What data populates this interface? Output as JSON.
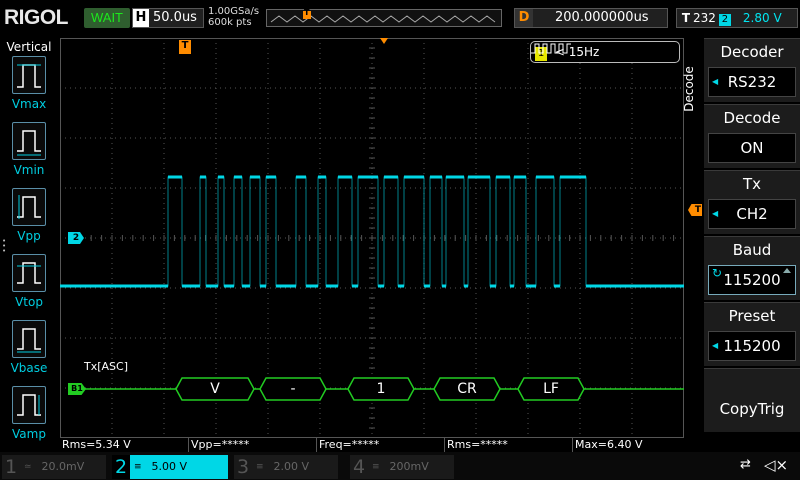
{
  "topbar": {
    "logo": "RIGOL",
    "run_state": "WAIT",
    "timebase_label": "H",
    "timebase_value": "50.0us",
    "sample_rate": "1.00GSa/s",
    "memory_depth": "600k pts",
    "trigger_position_marker": "T",
    "delay_label": "D",
    "delay_value": "200.000000us",
    "trigger_label": "T",
    "trigger_source": "2",
    "trigger_level": "2.80 V",
    "trigger_symbol": "232"
  },
  "left_menu": {
    "title": "Vertical",
    "items": [
      {
        "label": "Vmax",
        "icon": "vmax-icon"
      },
      {
        "label": "Vmin",
        "icon": "vmin-icon"
      },
      {
        "label": "Vpp",
        "icon": "vpp-icon"
      },
      {
        "label": "Vtop",
        "icon": "vtop-icon"
      },
      {
        "label": "Vbase",
        "icon": "vbase-icon"
      },
      {
        "label": "Vamp",
        "icon": "vamp-icon"
      }
    ]
  },
  "plot": {
    "trigger_marker": "T",
    "channel2_marker": "2",
    "trigger_level_marker": "T",
    "freq_box_channel": "1",
    "freq_box_text": "< 15Hz",
    "decode_label": "Tx[ASC]",
    "bus_marker": "B1",
    "decoded_frames": [
      "V",
      "-",
      "1",
      "CR",
      "LF"
    ],
    "colors": {
      "channel2": "#00d7e6",
      "bus": "#22cc22",
      "trigger": "#ff8c00",
      "grid": "#555555"
    }
  },
  "right_menu": {
    "side_title": "Decode",
    "items": [
      {
        "title": "Decoder",
        "value": "RS232"
      },
      {
        "title": "Decode",
        "value": "ON"
      },
      {
        "title": "Tx",
        "value": "CH2"
      },
      {
        "title": "Baud",
        "value": "115200"
      },
      {
        "title": "Preset",
        "value": "115200"
      },
      {
        "title": "",
        "value": "CopyTrig"
      }
    ]
  },
  "measurements": [
    "Rms=5.34 V",
    "Vpp=*****",
    "Freq=*****",
    "Rms=*****",
    "Max=6.40 V"
  ],
  "channels": [
    {
      "num": "1",
      "scale": "20.0mV"
    },
    {
      "num": "2",
      "scale": "5.00 V"
    },
    {
      "num": "3",
      "scale": "2.00 V"
    },
    {
      "num": "4",
      "scale": "200mV"
    }
  ]
}
